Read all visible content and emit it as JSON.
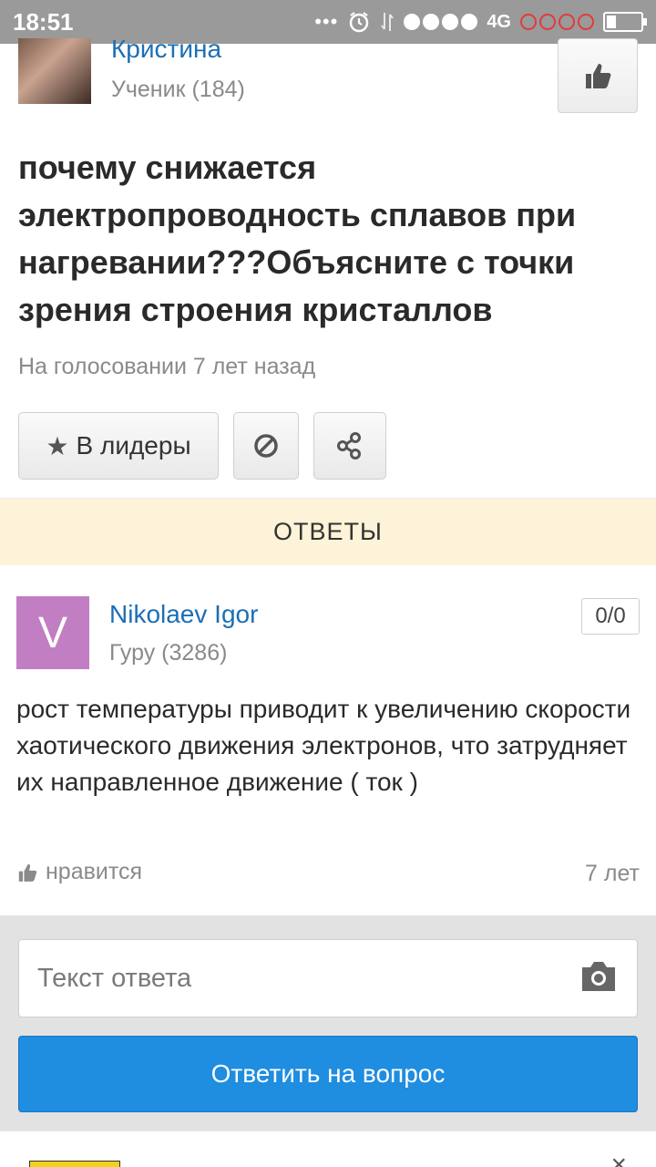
{
  "status_bar": {
    "time": "18:51",
    "dots": "•••",
    "network": "4G"
  },
  "question": {
    "author": {
      "name": "Кристина",
      "rank": "Ученик (184)"
    },
    "title": "почему снижается электропроводность сплавов при нагревании???Объясните с точки зрения строения кристаллов",
    "meta": "На голосовании 7 лет назад",
    "actions": {
      "leaders_label": "В лидеры",
      "star": "★"
    }
  },
  "answers_header": "ОТВЕТЫ",
  "answer": {
    "avatar_letter": "V",
    "avatar_color": "#c27ec2",
    "author": "Nikolaev Igor",
    "rank": "Гуру (3286)",
    "score": "0/0",
    "text": "рост температуры приводит к увеличению скорости хаотического движения электронов, что затрудняет их направленное движение ( ток )",
    "like_label": "нравится",
    "time": "7 лет"
  },
  "reply": {
    "placeholder": "Текст ответа",
    "submit_label": "Ответить на вопрос",
    "button_color": "#1f8de0"
  },
  "ad": {
    "close": "×"
  }
}
